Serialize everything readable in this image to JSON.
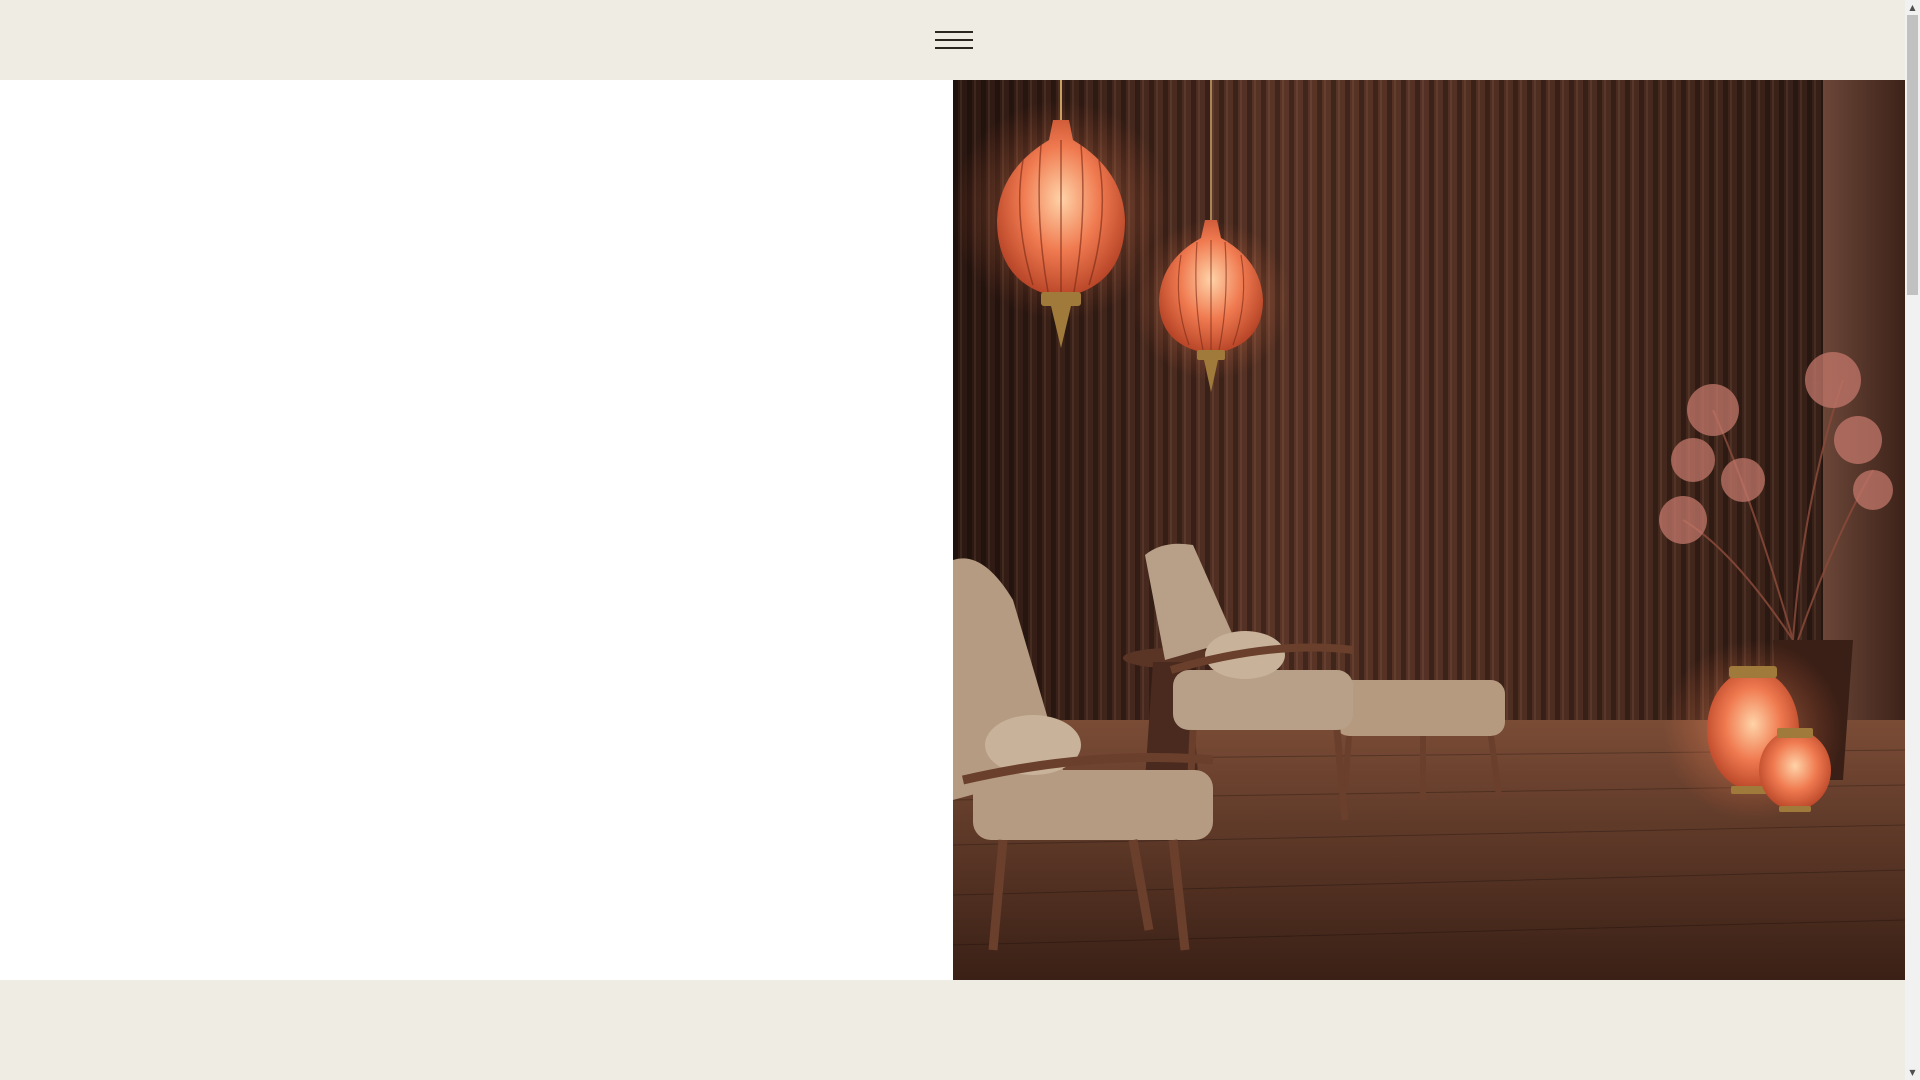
{
  "header": {
    "menu_icon": "hamburger-menu-icon"
  },
  "hero": {
    "image_subject": "spa-lounge-photo"
  },
  "scrollbar": {
    "up_glyph": "▲",
    "down_glyph": "▼"
  },
  "colors": {
    "background": "#efede3",
    "panel": "#ffffff",
    "text_dark": "#2b2620",
    "wood_dark": "#3a2219",
    "lantern": "#e8734f"
  }
}
